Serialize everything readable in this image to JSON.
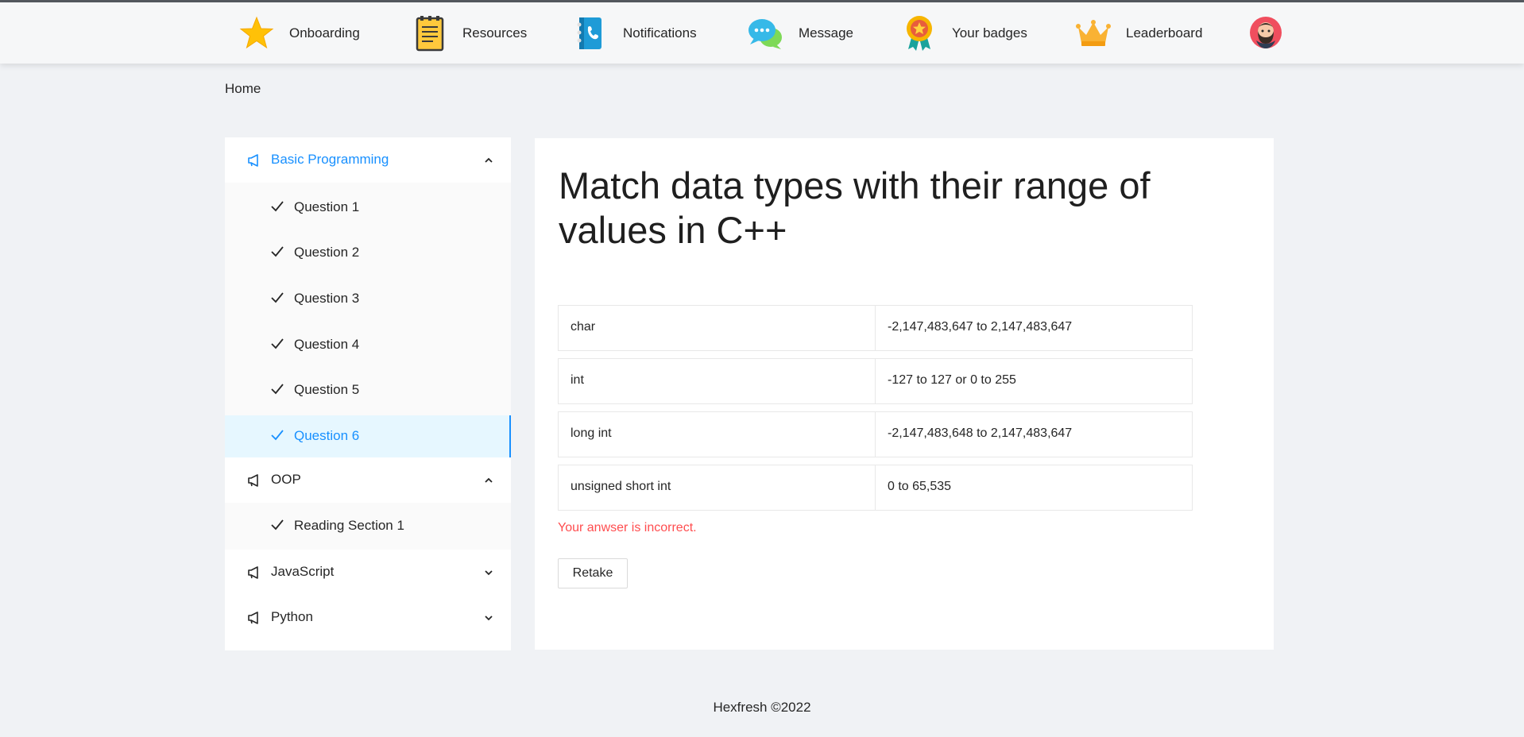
{
  "nav": {
    "items": [
      {
        "label": "Onboarding",
        "icon": "star-icon"
      },
      {
        "label": "Resources",
        "icon": "document-icon"
      },
      {
        "label": "Notifications",
        "icon": "phone-book-icon"
      },
      {
        "label": "Message",
        "icon": "chat-bubbles-icon"
      },
      {
        "label": "Your badges",
        "icon": "medal-icon"
      },
      {
        "label": "Leaderboard",
        "icon": "crown-icon"
      }
    ],
    "avatar_icon": "user-avatar-icon"
  },
  "breadcrumb": {
    "home": "Home"
  },
  "sidebar": {
    "sections": [
      {
        "label": "Basic Programming",
        "expanded": true,
        "active": true,
        "items": [
          "Question 1",
          "Question 2",
          "Question 3",
          "Question 4",
          "Question 5",
          "Question 6"
        ],
        "active_item": "Question 6"
      },
      {
        "label": "OOP",
        "expanded": true,
        "items": [
          "Reading Section 1"
        ]
      },
      {
        "label": "JavaScript",
        "expanded": false
      },
      {
        "label": "Python",
        "expanded": false
      }
    ]
  },
  "question": {
    "title": "Match data types with their range of values in C++",
    "pairs": [
      {
        "type": "char",
        "range": "-2,147,483,647 to 2,147,483,647"
      },
      {
        "type": "int",
        "range": "-127 to 127 or 0 to 255"
      },
      {
        "type": "long int",
        "range": "-2,147,483,648 to 2,147,483,647"
      },
      {
        "type": "unsigned short int",
        "range": "0 to 65,535"
      }
    ],
    "result_text": "Your anwser is incorrect.",
    "retake_label": "Retake"
  },
  "footer": {
    "text": "Hexfresh ©2022"
  },
  "colors": {
    "accent": "#1890ff",
    "error": "#ff4d4f",
    "background": "#f0f2f5"
  }
}
